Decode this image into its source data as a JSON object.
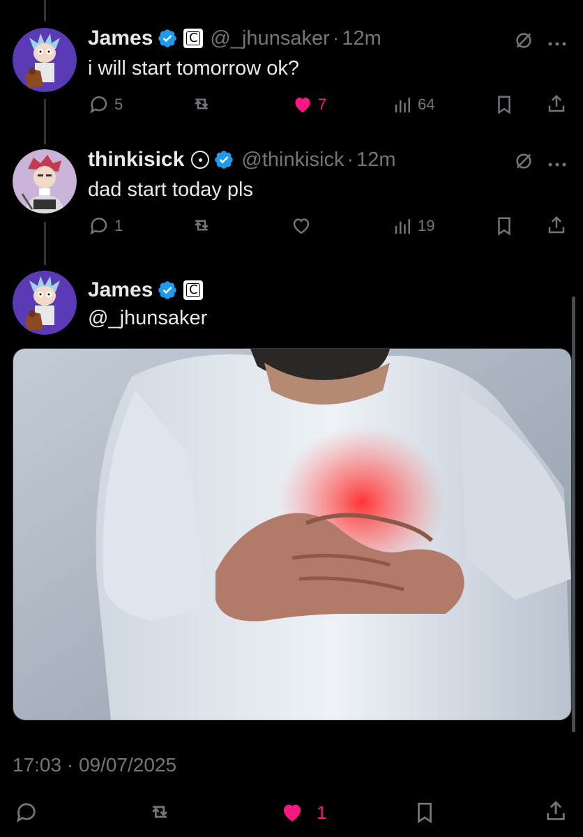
{
  "tweets": [
    {
      "name": "James",
      "handle": "@_jhunsaker",
      "separator": "·",
      "time": "12m",
      "text": "i will start tomorrow ok?",
      "replies": "5",
      "likes": "7",
      "views": "64",
      "liked": true,
      "badges": [
        "verified-icon",
        "c-badge-icon"
      ]
    },
    {
      "name": "thinkisick",
      "handle": "@thinkisick",
      "separator": "·",
      "time": "12m",
      "text": "dad start today pls",
      "replies": "1",
      "likes": "",
      "views": "19",
      "liked": false,
      "badges": [
        "ring-icon",
        "verified-icon"
      ]
    }
  ],
  "main_tweet": {
    "name": "James",
    "handle": "@_jhunsaker",
    "timestamp": "17:03 · 09/07/2025",
    "likes": "1",
    "badges": [
      "verified-icon",
      "c-badge-icon"
    ]
  },
  "badge_text": "C",
  "colors": {
    "background": "#000000",
    "text": "#e7e9ea",
    "muted": "#71767b",
    "like": "#f91880",
    "verified": "#1d9bf0",
    "thread_line": "#333639"
  }
}
